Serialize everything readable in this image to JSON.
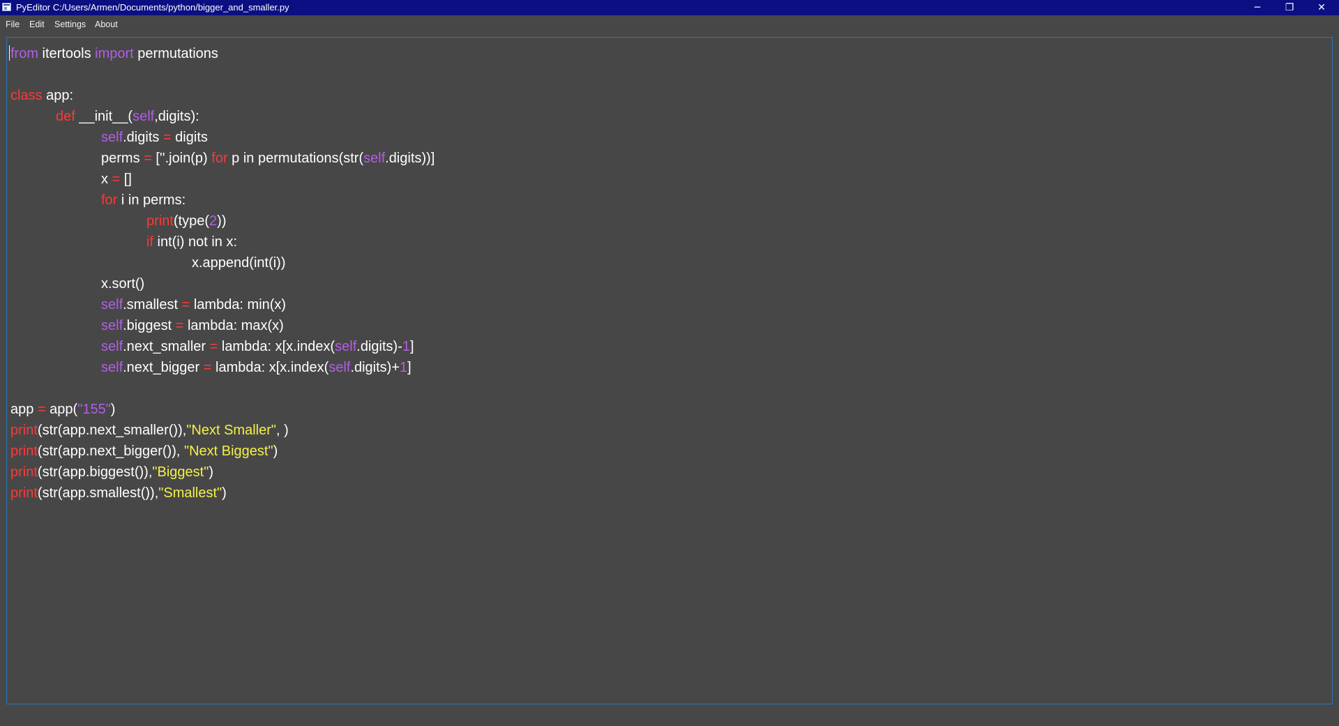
{
  "window": {
    "title": "PyEditor C:/Users/Armen/Documents/python/bigger_and_smaller.py",
    "minimize_glyph": "─",
    "maximize_glyph": "❐",
    "close_glyph": "✕"
  },
  "menu": {
    "items": [
      "File",
      "Edit",
      "Settings",
      "About"
    ]
  },
  "editor": {
    "colors": {
      "background": "#474747",
      "text": "#ffffff",
      "keyword": "#ff3838",
      "purple": "#b25ee6",
      "string": "#f3f14a",
      "title_bar": "#0b0f82"
    },
    "lines": [
      [
        [
          "pu",
          "from"
        ],
        [
          "",
          " itertools "
        ],
        [
          "pu",
          "import"
        ],
        [
          "",
          " permutations"
        ]
      ],
      [],
      [
        [
          "kw",
          "class"
        ],
        [
          "",
          " app:"
        ]
      ],
      [
        [
          "",
          "\t"
        ],
        [
          "kw",
          "def"
        ],
        [
          "",
          " __init__("
        ],
        [
          "pu",
          "self"
        ],
        [
          "",
          ",digits):"
        ]
      ],
      [
        [
          "",
          "\t\t"
        ],
        [
          "pu",
          "self"
        ],
        [
          "",
          ".digits "
        ],
        [
          "kw",
          "="
        ],
        [
          "",
          " digits"
        ]
      ],
      [
        [
          "",
          "\t\tperms "
        ],
        [
          "kw",
          "="
        ],
        [
          "",
          " [''.join(p) "
        ],
        [
          "kw",
          "for"
        ],
        [
          "",
          " p in permutations(str("
        ],
        [
          "pu",
          "self"
        ],
        [
          "",
          ".digits))]"
        ]
      ],
      [
        [
          "",
          "\t\tx "
        ],
        [
          "kw",
          "="
        ],
        [
          "",
          " []"
        ]
      ],
      [
        [
          "",
          "\t\t"
        ],
        [
          "kw",
          "for"
        ],
        [
          "",
          " i in perms:"
        ]
      ],
      [
        [
          "",
          "\t\t\t"
        ],
        [
          "kw",
          "print"
        ],
        [
          "",
          "(type("
        ],
        [
          "pu",
          "2"
        ],
        [
          "",
          "))"
        ]
      ],
      [
        [
          "",
          "\t\t\t"
        ],
        [
          "kw",
          "if"
        ],
        [
          "",
          " int(i) not in x:"
        ]
      ],
      [
        [
          "",
          "\t\t\t\tx.append(int(i))"
        ]
      ],
      [
        [
          "",
          "\t\tx.sort()"
        ]
      ],
      [
        [
          "",
          "\t\t"
        ],
        [
          "pu",
          "self"
        ],
        [
          "",
          ".smallest "
        ],
        [
          "kw",
          "="
        ],
        [
          "",
          " lambda: min(x)"
        ]
      ],
      [
        [
          "",
          "\t\t"
        ],
        [
          "pu",
          "self"
        ],
        [
          "",
          ".biggest "
        ],
        [
          "kw",
          "="
        ],
        [
          "",
          " lambda: max(x)"
        ]
      ],
      [
        [
          "",
          "\t\t"
        ],
        [
          "pu",
          "self"
        ],
        [
          "",
          ".next_smaller "
        ],
        [
          "kw",
          "="
        ],
        [
          "",
          " lambda: x[x.index("
        ],
        [
          "pu",
          "self"
        ],
        [
          "",
          ".digits)-"
        ],
        [
          "pu",
          "1"
        ],
        [
          "",
          "]"
        ]
      ],
      [
        [
          "",
          "\t\t"
        ],
        [
          "pu",
          "self"
        ],
        [
          "",
          ".next_bigger "
        ],
        [
          "kw",
          "="
        ],
        [
          "",
          " lambda: x[x.index("
        ],
        [
          "pu",
          "self"
        ],
        [
          "",
          ".digits)+"
        ],
        [
          "pu",
          "1"
        ],
        [
          "",
          "]"
        ]
      ],
      [],
      [
        [
          "",
          "app "
        ],
        [
          "kw",
          "="
        ],
        [
          "",
          " app("
        ],
        [
          "pu",
          "\"155\""
        ],
        [
          "",
          ")"
        ]
      ],
      [
        [
          "kw",
          "print"
        ],
        [
          "",
          "(str(app.next_smaller()),"
        ],
        [
          "st",
          "\"Next Smaller\""
        ],
        [
          "",
          ", )"
        ]
      ],
      [
        [
          "kw",
          "print"
        ],
        [
          "",
          "(str(app.next_bigger()), "
        ],
        [
          "st",
          "\"Next Biggest\""
        ],
        [
          "",
          ")"
        ]
      ],
      [
        [
          "kw",
          "print"
        ],
        [
          "",
          "(str(app.biggest()),"
        ],
        [
          "st",
          "\"Biggest\""
        ],
        [
          "",
          ")"
        ]
      ],
      [
        [
          "kw",
          "print"
        ],
        [
          "",
          "(str(app.smallest()),"
        ],
        [
          "st",
          "\"Smallest\""
        ],
        [
          "",
          ")"
        ]
      ]
    ]
  }
}
